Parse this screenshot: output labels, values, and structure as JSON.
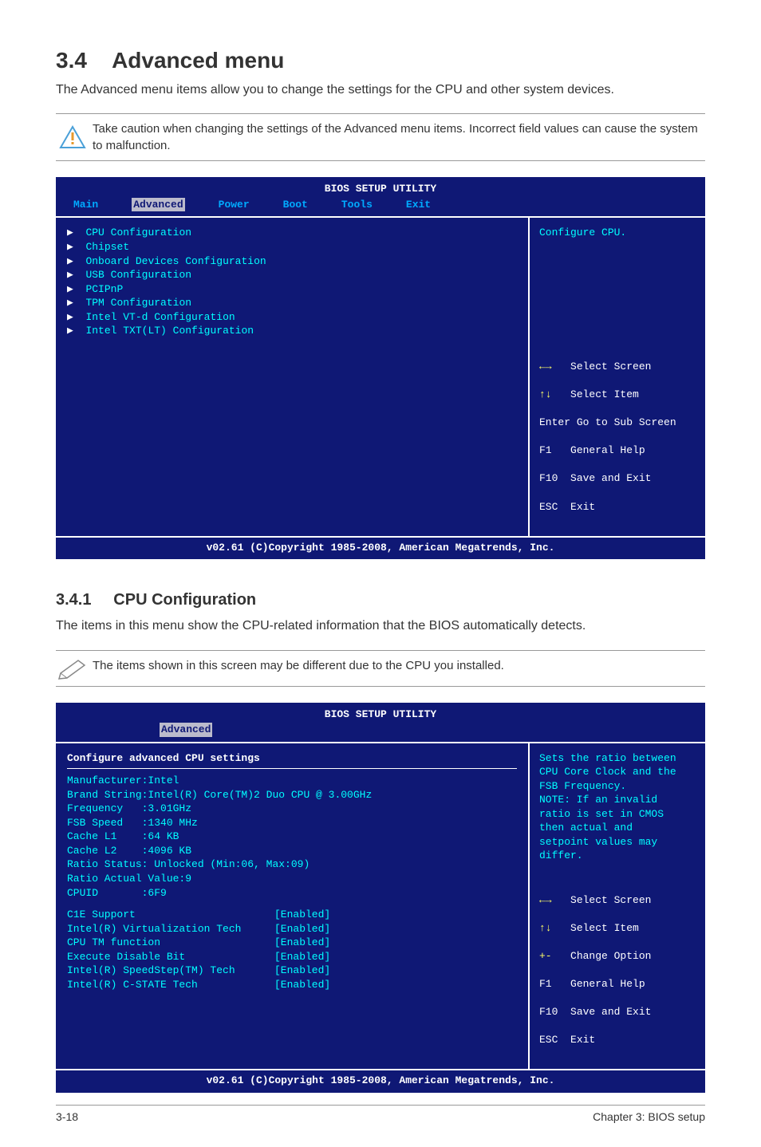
{
  "section": {
    "number": "3.4",
    "title": "Advanced menu"
  },
  "intro": "The Advanced menu items allow you to change the settings for the CPU and other system devices.",
  "caution": "Take caution when changing the settings of the Advanced menu items. Incorrect field values can cause the system to malfunction.",
  "bios1": {
    "title": "BIOS SETUP UTILITY",
    "tabs": {
      "main": "Main",
      "advanced": "Advanced",
      "power": "Power",
      "boot": "Boot",
      "tools": "Tools",
      "exit": "Exit"
    },
    "items": {
      "i1": "CPU Configuration",
      "i2": "Chipset",
      "i3": "Onboard Devices Configuration",
      "i4": "USB Configuration",
      "i5": "PCIPnP",
      "i6": "TPM Configuration",
      "i7": "Intel VT-d Configuration",
      "i8": "Intel TXT(LT) Configuration"
    },
    "help": "Configure CPU.",
    "nav": {
      "l1": "Select Screen",
      "l2": "Select Item",
      "l3a": "Enter",
      "l3b": "Go to Sub Screen",
      "l4a": "F1",
      "l4b": "General Help",
      "l5a": "F10",
      "l5b": "Save and Exit",
      "l6a": "ESC",
      "l6b": "Exit"
    },
    "footer": "v02.61 (C)Copyright 1985-2008, American Megatrends, Inc."
  },
  "subsection": {
    "number": "3.4.1",
    "title": "CPU Configuration"
  },
  "sub_intro": "The items in this menu show the CPU-related information that the BIOS automatically detects.",
  "note": "The items shown in this screen may be different due to the CPU you installed.",
  "bios2": {
    "title": "BIOS SETUP UTILITY",
    "tab": "Advanced",
    "header": "Configure advanced CPU settings",
    "info": {
      "l1": "Manufacturer:Intel",
      "l2": "Brand String:Intel(R) Core(TM)2 Duo CPU @ 3.00GHz",
      "l3": "Frequency   :3.01GHz",
      "l4": "FSB Speed   :1340 MHz",
      "l5": "Cache L1    :64 KB",
      "l6": "Cache L2    :4096 KB",
      "l7": "Ratio Status: Unlocked (Min:06, Max:09)",
      "l8": "Ratio Actual Value:9",
      "l9": "CPUID       :6F9"
    },
    "opts": {
      "o1l": "C1E Support",
      "o1v": "[Enabled]",
      "o2l": "Intel(R) Virtualization Tech",
      "o2v": "[Enabled]",
      "o3l": "CPU TM function",
      "o3v": "[Enabled]",
      "o4l": "Execute Disable Bit",
      "o4v": "[Enabled]",
      "o5l": "Intel(R) SpeedStep(TM) Tech",
      "o5v": "[Enabled]",
      "o6l": "Intel(R) C-STATE Tech",
      "o6v": "[Enabled]"
    },
    "help": "Sets the ratio between CPU Core Clock and the FSB Frequency.\nNOTE: If an invalid ratio is set in CMOS then actual and setpoint values may differ.",
    "help_lines": {
      "h1": "Sets the ratio between",
      "h2": "CPU Core Clock and the",
      "h3": "FSB Frequency.",
      "h4": "NOTE: If an invalid",
      "h5": "ratio is set in CMOS",
      "h6": "then actual and",
      "h7": "setpoint values may",
      "h8": "differ."
    },
    "nav": {
      "l1": "Select Screen",
      "l2": "Select Item",
      "l3a": "+-",
      "l3b": "Change Option",
      "l4a": "F1",
      "l4b": "General Help",
      "l5a": "F10",
      "l5b": "Save and Exit",
      "l6a": "ESC",
      "l6b": "Exit"
    },
    "footer": "v02.61 (C)Copyright 1985-2008, American Megatrends, Inc."
  },
  "page": {
    "left": "3-18",
    "right": "Chapter 3: BIOS setup"
  }
}
